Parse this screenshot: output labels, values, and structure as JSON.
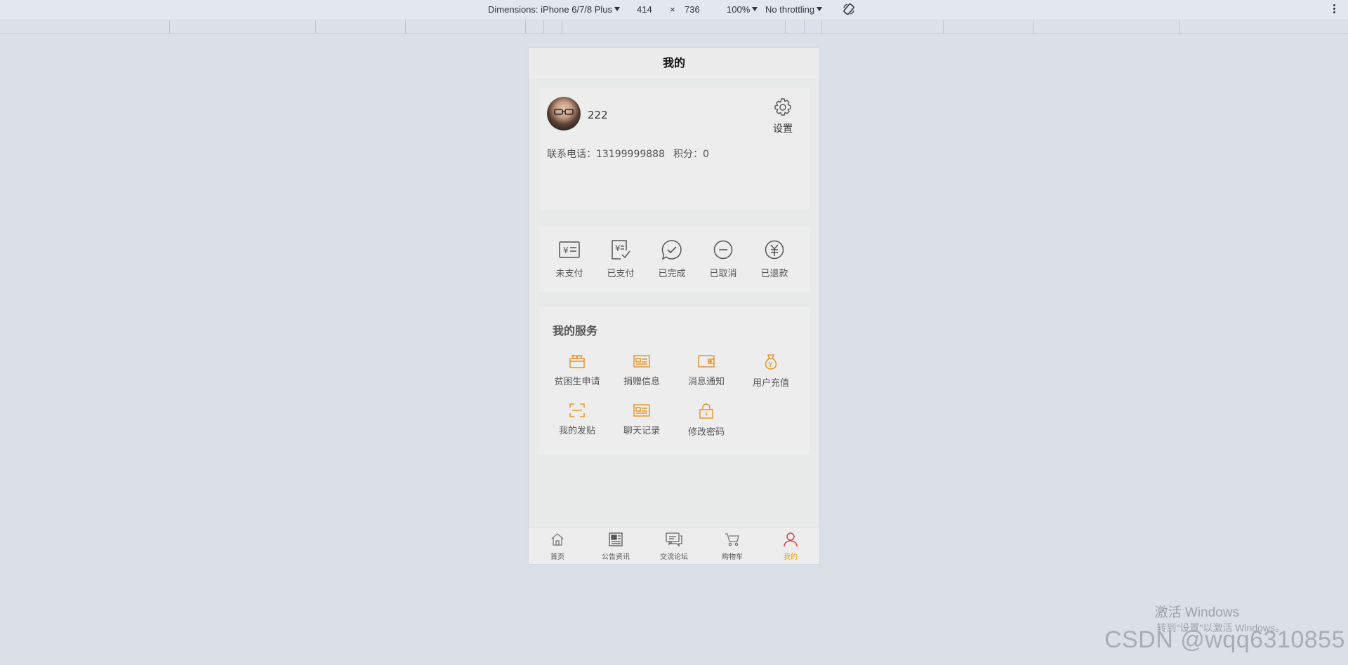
{
  "devtools": {
    "dimensions_label": "Dimensions: iPhone 6/7/8 Plus",
    "width": "414",
    "times": "×",
    "height": "736",
    "zoom": "100%",
    "throttling": "No throttling"
  },
  "page": {
    "title": "我的"
  },
  "profile": {
    "username": "222",
    "settings_label": "设置",
    "phone_label": "联系电话：",
    "phone": "13199999888",
    "points_label": "积分：",
    "points": "0"
  },
  "orders": [
    {
      "label": "未支付",
      "icon": "unpaid-icon"
    },
    {
      "label": "已支付",
      "icon": "paid-icon"
    },
    {
      "label": "已完成",
      "icon": "completed-icon"
    },
    {
      "label": "已取消",
      "icon": "cancelled-icon"
    },
    {
      "label": "已退款",
      "icon": "refunded-icon"
    }
  ],
  "services": {
    "title": "我的服务",
    "items": [
      {
        "label": "贫困生申请",
        "icon": "gift-icon"
      },
      {
        "label": "捐赠信息",
        "icon": "card-icon"
      },
      {
        "label": "消息通知",
        "icon": "wallet-icon"
      },
      {
        "label": "用户充值",
        "icon": "money-bag-icon"
      },
      {
        "label": "我的发贴",
        "icon": "scan-icon"
      },
      {
        "label": "聊天记录",
        "icon": "card-icon"
      },
      {
        "label": "修改密码",
        "icon": "lock-icon"
      }
    ]
  },
  "tabbar": [
    {
      "label": "首页",
      "icon": "home-icon"
    },
    {
      "label": "公告资讯",
      "icon": "news-icon"
    },
    {
      "label": "交流论坛",
      "icon": "chat-icon"
    },
    {
      "label": "购物车",
      "icon": "cart-icon"
    },
    {
      "label": "我的",
      "icon": "user-icon",
      "active": true
    }
  ],
  "colors": {
    "accent_orange": "#e8a316",
    "active_tab_icon": "#e0454f",
    "service_icon": "#e9952a"
  },
  "watermarks": {
    "activate_title": "激活 Windows",
    "activate_sub": "转到\"设置\"以激活 Windows。",
    "csdn": "CSDN @wqq6310855"
  }
}
